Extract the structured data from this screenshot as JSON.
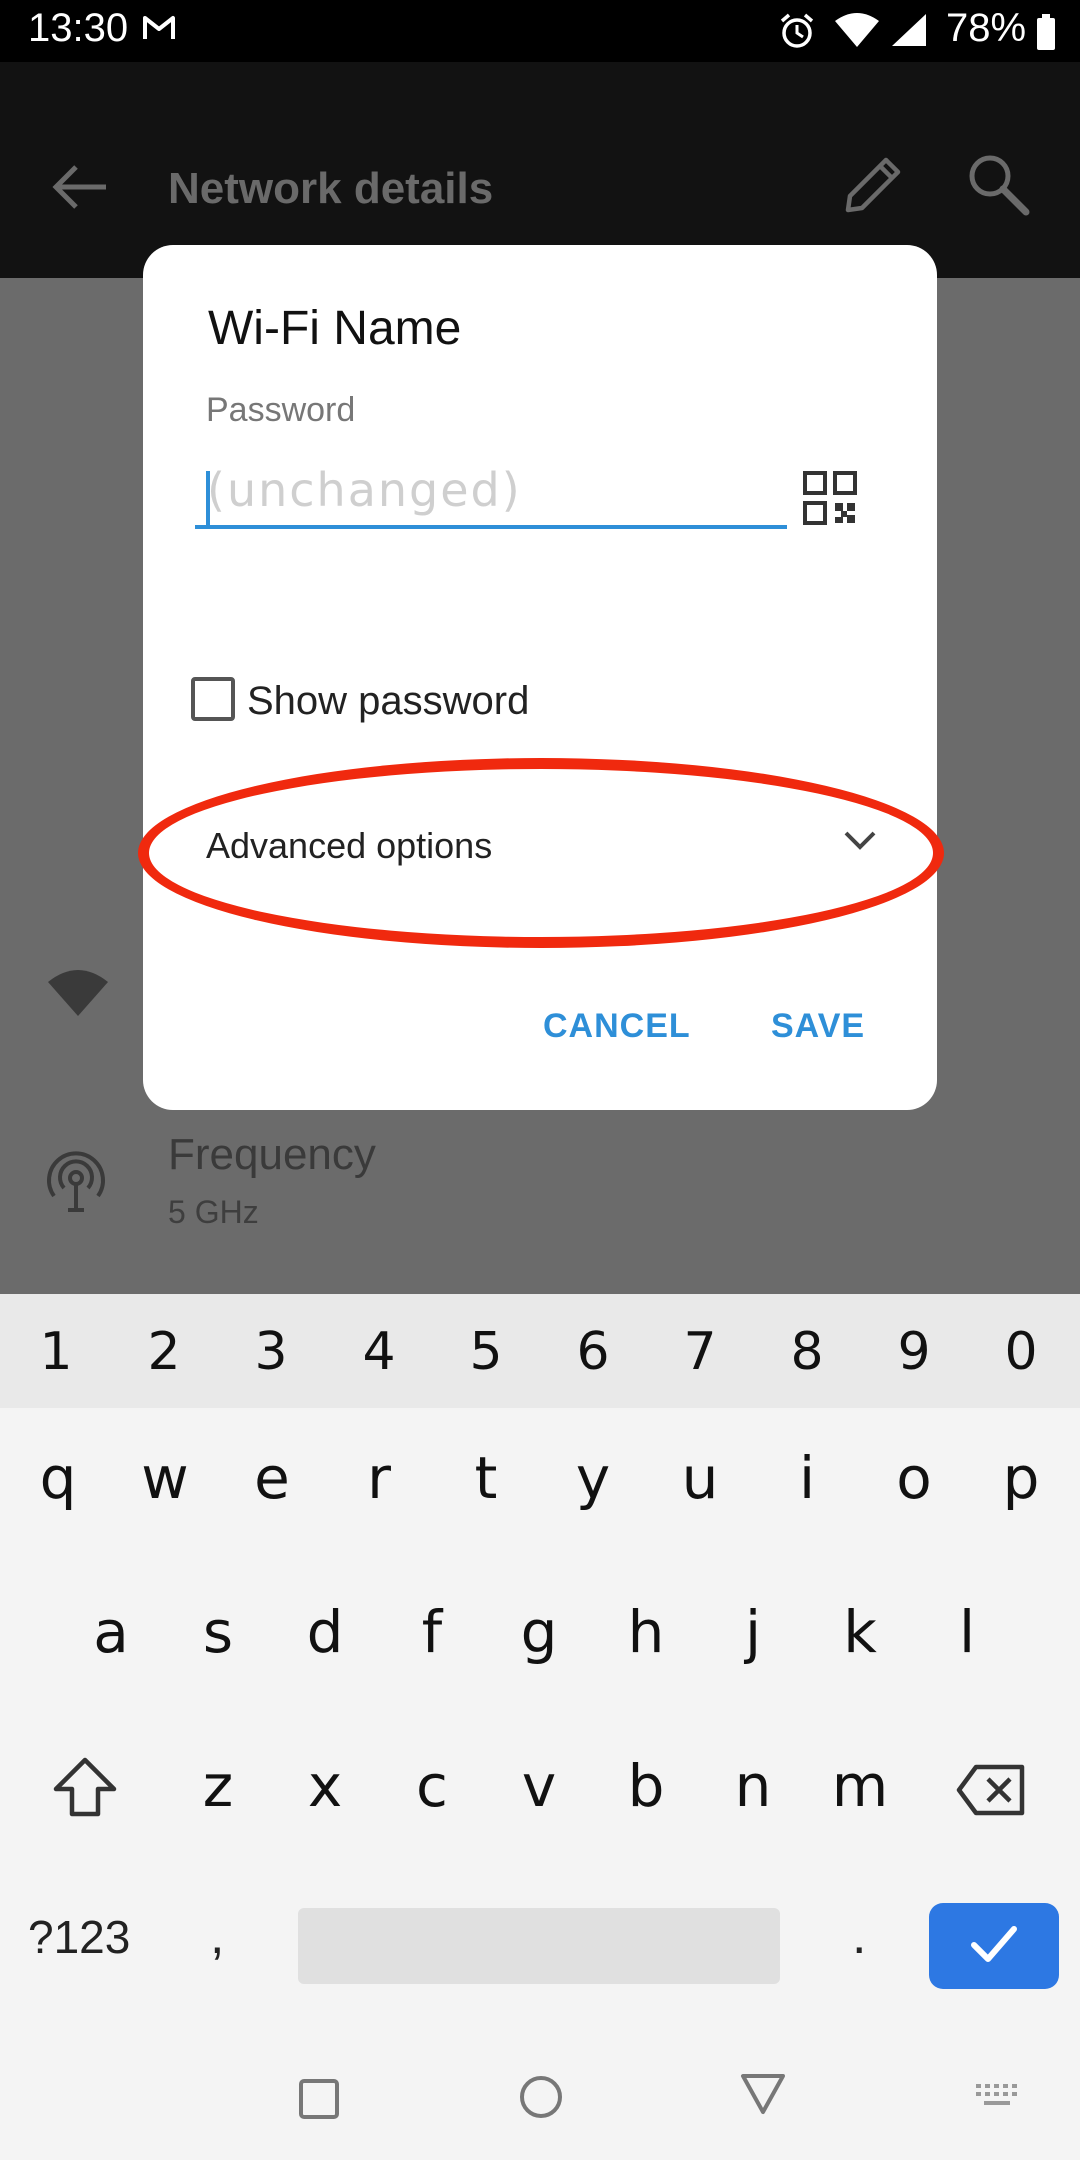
{
  "status_bar": {
    "time": "13:30",
    "battery": "78%"
  },
  "app_bar": {
    "title": "Network details"
  },
  "background_content": {
    "frequency_title": "Frequency",
    "frequency_value": "5 GHz"
  },
  "dialog": {
    "title": "Wi-Fi Name",
    "password_label": "Password",
    "password_placeholder": "(unchanged)",
    "show_password_label": "Show password",
    "show_password_checked": false,
    "advanced_options_label": "Advanced options",
    "cancel_label": "CANCEL",
    "save_label": "SAVE"
  },
  "highlight": {
    "color": "#f0290e"
  },
  "keyboard": {
    "number_row": [
      "1",
      "2",
      "3",
      "4",
      "5",
      "6",
      "7",
      "8",
      "9",
      "0"
    ],
    "row1": [
      "q",
      "w",
      "e",
      "r",
      "t",
      "y",
      "u",
      "i",
      "o",
      "p"
    ],
    "row2": [
      "a",
      "s",
      "d",
      "f",
      "g",
      "h",
      "j",
      "k",
      "l"
    ],
    "row3": [
      "z",
      "x",
      "c",
      "v",
      "b",
      "n",
      "m"
    ],
    "symbols_label": "?123",
    "comma": ",",
    "period": "."
  },
  "colors": {
    "accent": "#2e8fd8",
    "enter_key": "#2d78e3"
  }
}
